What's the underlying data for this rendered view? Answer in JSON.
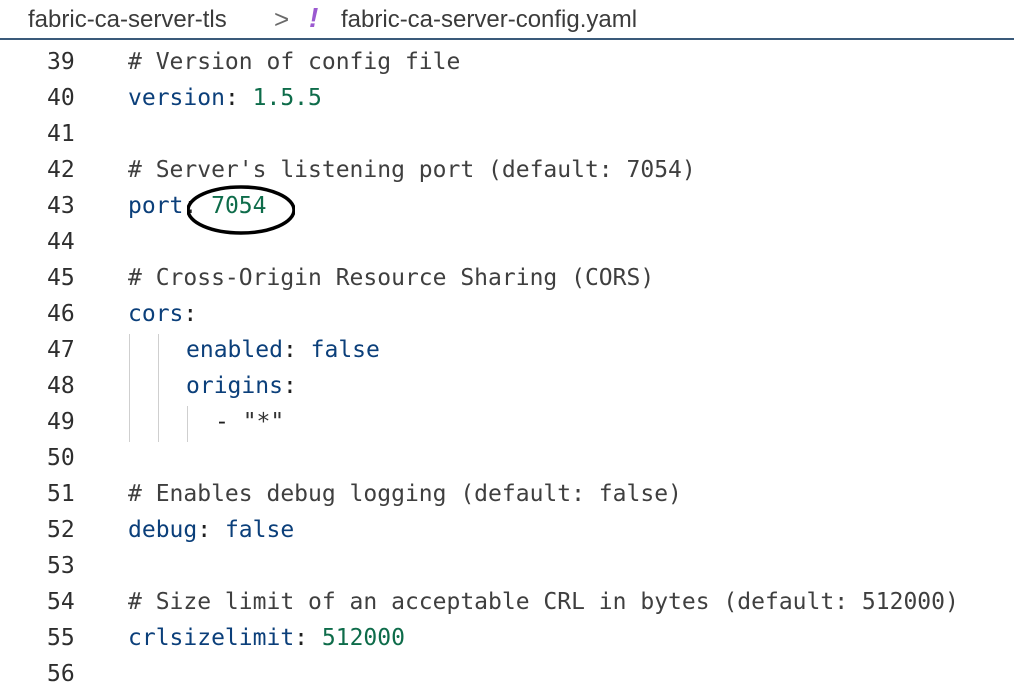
{
  "breadcrumb": {
    "folder": "fabric-ca-server-tls",
    "separator": ">",
    "file_icon": "!",
    "file_icon_name": "yaml-file-icon",
    "file": "fabric-ca-server-config.yaml"
  },
  "colors": {
    "comment": "#3f3f3f",
    "key": "#0b3f7a",
    "number": "#0e6c4a",
    "annotation": "#000000",
    "file_icon": "#9b59d0"
  },
  "lines": [
    {
      "num": "39",
      "tokens": [
        {
          "t": "comment",
          "v": "# Version of config file"
        }
      ]
    },
    {
      "num": "40",
      "tokens": [
        {
          "t": "key",
          "v": "version"
        },
        {
          "t": "punct",
          "v": ": "
        },
        {
          "t": "num",
          "v": "1.5.5"
        }
      ]
    },
    {
      "num": "41",
      "tokens": []
    },
    {
      "num": "42",
      "tokens": [
        {
          "t": "comment",
          "v": "# Server's listening port (default: 7054)"
        }
      ]
    },
    {
      "num": "43",
      "tokens": [
        {
          "t": "key",
          "v": "port"
        },
        {
          "t": "punct",
          "v": ": "
        },
        {
          "t": "num",
          "v": "7054"
        }
      ]
    },
    {
      "num": "44",
      "tokens": []
    },
    {
      "num": "45",
      "tokens": [
        {
          "t": "comment",
          "v": "# Cross-Origin Resource Sharing (CORS)"
        }
      ]
    },
    {
      "num": "46",
      "tokens": [
        {
          "t": "key",
          "v": "cors"
        },
        {
          "t": "punct",
          "v": ":"
        }
      ]
    },
    {
      "num": "47",
      "tokens": [
        {
          "t": "key",
          "v": "enabled"
        },
        {
          "t": "punct",
          "v": ": "
        },
        {
          "t": "bool",
          "v": "false"
        }
      ]
    },
    {
      "num": "48",
      "tokens": [
        {
          "t": "key",
          "v": "origins"
        },
        {
          "t": "punct",
          "v": ":"
        }
      ]
    },
    {
      "num": "49",
      "tokens": [
        {
          "t": "punct",
          "v": "- "
        },
        {
          "t": "str",
          "v": "\"*\""
        }
      ]
    },
    {
      "num": "50",
      "tokens": []
    },
    {
      "num": "51",
      "tokens": [
        {
          "t": "comment",
          "v": "# Enables debug logging (default: false)"
        }
      ]
    },
    {
      "num": "52",
      "tokens": [
        {
          "t": "key",
          "v": "debug"
        },
        {
          "t": "punct",
          "v": ": "
        },
        {
          "t": "bool",
          "v": "false"
        }
      ]
    },
    {
      "num": "53",
      "tokens": []
    },
    {
      "num": "54",
      "tokens": [
        {
          "t": "comment",
          "v": "# Size limit of an acceptable CRL in bytes (default: 512000)"
        }
      ]
    },
    {
      "num": "55",
      "tokens": [
        {
          "t": "key",
          "v": "crlsizelimit"
        },
        {
          "t": "punct",
          "v": ": "
        },
        {
          "t": "num",
          "v": "512000"
        }
      ]
    },
    {
      "num": "56",
      "tokens": []
    }
  ]
}
